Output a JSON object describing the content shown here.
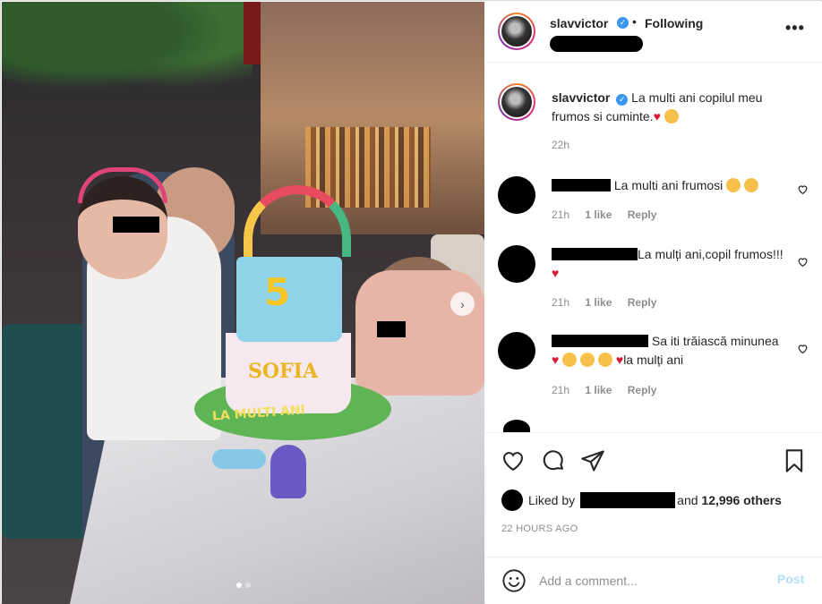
{
  "post": {
    "author": "slavvictor",
    "verified_icon": "verified-badge-icon",
    "follow_status": "Following",
    "separator": "•",
    "more_icon": "more-options-icon",
    "more_label": "•••"
  },
  "photo": {
    "cake_number": "5",
    "cake_name": "SOFIA",
    "cake_message": "LA MULTI ANI",
    "carousel": {
      "current": 1,
      "total": 2
    },
    "next_icon": "chevron-right-icon",
    "next_label": "›"
  },
  "caption": {
    "username": "slavvictor",
    "text": "La multi ani copilul meu frumos si cuminte.",
    "time": "22h"
  },
  "comments": [
    {
      "text": "La multi ani frumosi",
      "time": "21h",
      "likes": "1 like",
      "reply": "Reply"
    },
    {
      "text": "La mulți ani,copil frumos!!!",
      "time": "21h",
      "likes": "1 like",
      "reply": "Reply"
    },
    {
      "text": "Sa iti trăiască minunea",
      "text_end": "la mulți ani",
      "time": "21h",
      "likes": "1 like",
      "reply": "Reply"
    }
  ],
  "actions": {
    "like_icon": "heart-icon",
    "comment_icon": "comment-icon",
    "share_icon": "paper-plane-icon",
    "save_icon": "bookmark-icon"
  },
  "likes": {
    "prefix": "Liked by",
    "connector": "and",
    "others": "12,996 others"
  },
  "timestamp": "22 HOURS AGO",
  "add_comment": {
    "placeholder": "Add a comment...",
    "post_label": "Post",
    "emoji_icon": "smiley-icon"
  },
  "colors": {
    "verified": "#3897f0",
    "heart": "#d81b34",
    "post_disabled": "#b2dffc",
    "muted": "#8e8e8e"
  }
}
